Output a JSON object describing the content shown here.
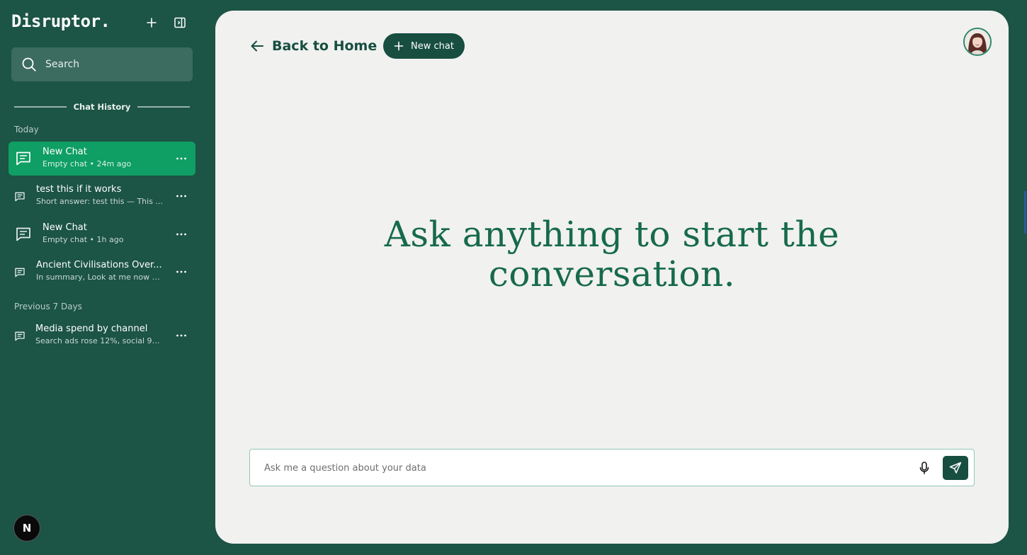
{
  "brand": {
    "logo": "Disruptor."
  },
  "sidebar": {
    "search_label": "Search",
    "history_heading": "Chat History",
    "groups": [
      {
        "label": "Today"
      },
      {
        "label": "Previous 7 Days"
      }
    ],
    "items": [
      {
        "title": "New Chat",
        "subtitle": "Empty chat • 24m ago",
        "active": true
      },
      {
        "title": "test this if it works",
        "subtitle": "Short answer: test this — This ...",
        "active": false
      },
      {
        "title": "New Chat",
        "subtitle": "Empty chat • 1h ago",
        "active": false
      },
      {
        "title": "Ancient Civilisations Over...",
        "subtitle": "In summary, Look at me now —...",
        "active": false
      },
      {
        "title": "Media spend by channel",
        "subtitle": "Search ads rose 12%, social 9%...",
        "active": false
      }
    ],
    "badge_letter": "N"
  },
  "header": {
    "back_label": "Back to Home",
    "new_chat_label": "New chat"
  },
  "hero": {
    "line1": "Ask anything to start the",
    "line2": "conversation."
  },
  "composer": {
    "placeholder": "Ask me a question about your data",
    "value": ""
  },
  "colors": {
    "sidebar_bg": "#1c5445",
    "accent": "#0f9e63",
    "brand_dark": "#174e40",
    "panel_bg": "#f1f1f0",
    "hero_text": "#176a4c"
  },
  "icons": {
    "new_chat": "plus-icon",
    "collapse": "sidebar-collapse-icon",
    "search": "search-icon",
    "chat": "message-icon",
    "more": "more-horizontal-icon",
    "back": "arrow-left-icon",
    "mic": "microphone-icon",
    "send": "send-icon"
  }
}
